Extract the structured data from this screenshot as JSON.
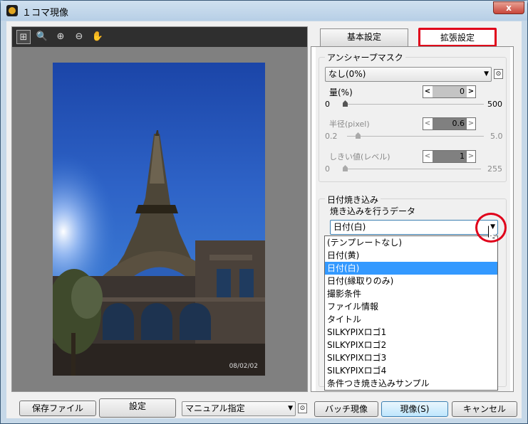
{
  "window": {
    "title": "１コマ現像",
    "close_label": "x"
  },
  "toolbar": {
    "tools": [
      {
        "icon": "fit-view-icon",
        "glyph": "⊞"
      },
      {
        "icon": "magnifier-icon",
        "glyph": "🔍"
      },
      {
        "icon": "zoom-in-icon",
        "glyph": "⊕"
      },
      {
        "icon": "zoom-out-icon",
        "glyph": "⊖"
      },
      {
        "icon": "hand-pan-icon",
        "glyph": "✋"
      }
    ]
  },
  "photo": {
    "date_stamp": "08/02/02"
  },
  "tabs": [
    {
      "label": "基本設定"
    },
    {
      "label": "拡張設定"
    }
  ],
  "unsharp": {
    "title": "アンシャープマスク",
    "preset": "なし(0%)",
    "amount": {
      "label": "量(%)",
      "value": "0",
      "min": "0",
      "max": "500"
    },
    "radius": {
      "label": "半径(pixel)",
      "value": "0.6",
      "min": "0.2",
      "max": "5.0"
    },
    "threshold": {
      "label": "しきい値(レベル)",
      "value": "1",
      "min": "0",
      "max": "255"
    }
  },
  "date_imprint": {
    "title": "日付焼き込み",
    "data_label": "焼き込みを行うデータ",
    "selected": "日付(白)",
    "options": [
      "(テンプレートなし)",
      "日付(黄)",
      "日付(白)",
      "日付(縁取りのみ)",
      "撮影条件",
      "ファイル情報",
      "タイトル",
      "SILKYPIXロゴ1",
      "SILKYPIXロゴ2",
      "SILKYPIXロゴ3",
      "SILKYPIXロゴ4",
      "条件つき焼き込みサンプル"
    ]
  },
  "bottom": {
    "save_file": "保存ファイル",
    "settings": "設定",
    "mode": "マニュアル指定",
    "batch": "バッチ現像",
    "develop": "現像(S)",
    "cancel": "キャンセル"
  }
}
